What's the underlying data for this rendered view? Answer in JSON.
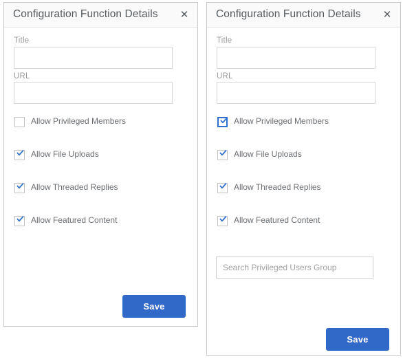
{
  "dialogs": [
    {
      "id": "left",
      "title": "Configuration Function Details",
      "close_icon": "close-icon",
      "fields": {
        "title": {
          "label": "Title",
          "value": "",
          "placeholder": ""
        },
        "url": {
          "label": "URL",
          "value": "",
          "placeholder": ""
        }
      },
      "checkboxes": [
        {
          "label": "Allow Privileged Members",
          "checked": false,
          "focused": false
        },
        {
          "label": "Allow File Uploads",
          "checked": true,
          "focused": false
        },
        {
          "label": "Allow Threaded Replies",
          "checked": true,
          "focused": false
        },
        {
          "label": "Allow Featured Content",
          "checked": true,
          "focused": false
        }
      ],
      "search": {
        "visible": false,
        "placeholder": "Search Privileged Users Group",
        "value": ""
      },
      "save_label": "Save"
    },
    {
      "id": "right",
      "title": "Configuration Function Details",
      "close_icon": "close-icon",
      "fields": {
        "title": {
          "label": "Title",
          "value": "",
          "placeholder": ""
        },
        "url": {
          "label": "URL",
          "value": "",
          "placeholder": ""
        }
      },
      "checkboxes": [
        {
          "label": "Allow Privileged Members",
          "checked": true,
          "focused": true
        },
        {
          "label": "Allow File Uploads",
          "checked": true,
          "focused": false
        },
        {
          "label": "Allow Threaded Replies",
          "checked": true,
          "focused": false
        },
        {
          "label": "Allow Featured Content",
          "checked": true,
          "focused": false
        }
      ],
      "search": {
        "visible": true,
        "placeholder": "Search Privileged Users Group",
        "value": ""
      },
      "save_label": "Save"
    }
  ],
  "colors": {
    "accent": "#3069c8",
    "checkmark": "#2f6fd0",
    "border": "#c8c8c8",
    "header_bg": "#fafafa",
    "label_text": "#9a9a9a",
    "body_text": "#6a6e72"
  }
}
